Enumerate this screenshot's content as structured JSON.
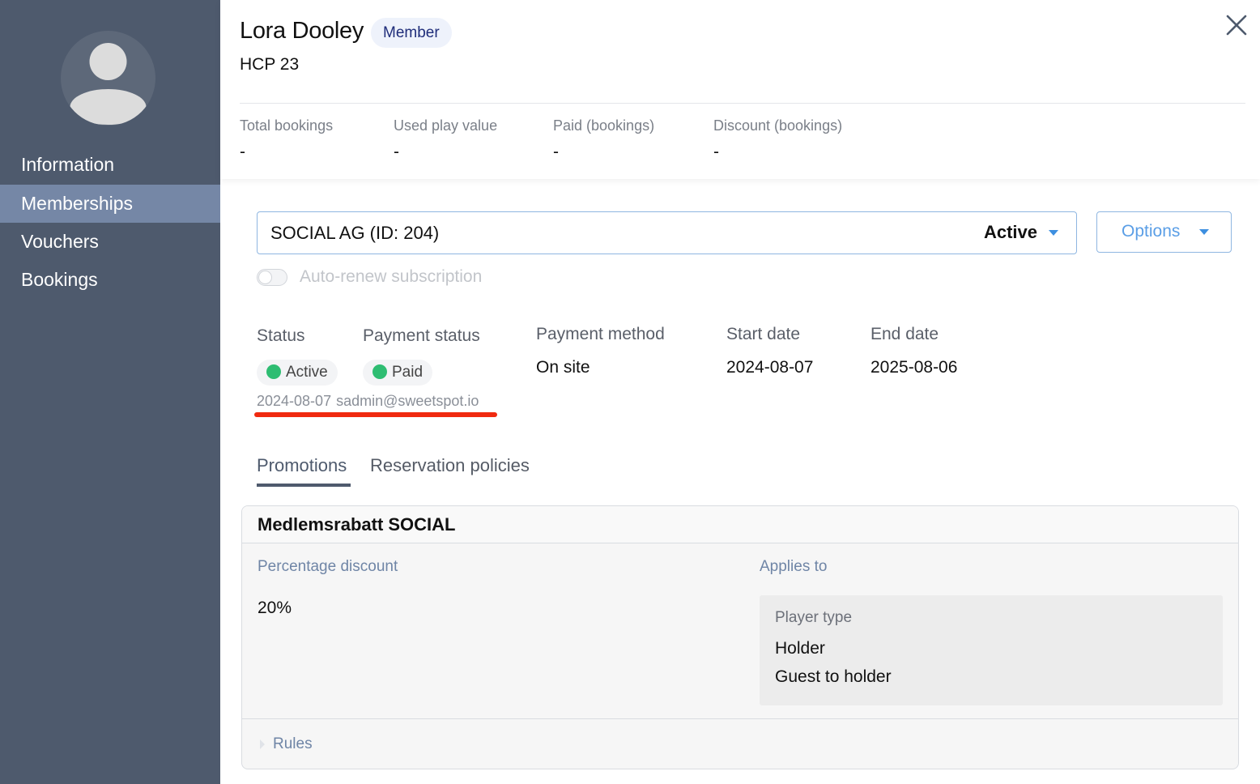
{
  "sidebar": {
    "items": [
      {
        "label": "Information"
      },
      {
        "label": "Memberships"
      },
      {
        "label": "Vouchers"
      },
      {
        "label": "Bookings"
      }
    ],
    "active_index": 1
  },
  "header": {
    "name": "Lora Dooley",
    "badge": "Member",
    "hcp": "HCP 23",
    "stats": [
      {
        "label": "Total bookings",
        "value": "-"
      },
      {
        "label": "Used play value",
        "value": "-"
      },
      {
        "label": "Paid (bookings)",
        "value": "-"
      },
      {
        "label": "Discount (bookings)",
        "value": "-"
      }
    ]
  },
  "membership": {
    "title": "SOCIAL AG (ID: 204)",
    "state": "Active",
    "options_label": "Options",
    "auto_renew_label": "Auto-renew subscription",
    "details": {
      "status_label": "Status",
      "status_value": "Active",
      "payment_status_label": "Payment status",
      "payment_status_value": "Paid",
      "payment_method_label": "Payment method",
      "payment_method_value": "On site",
      "start_date_label": "Start date",
      "start_date_value": "2024-08-07",
      "end_date_label": "End date",
      "end_date_value": "2025-08-06",
      "paid_date": "2024-08-07",
      "paid_by": "sadmin@sweetspot.io"
    }
  },
  "tabs": [
    {
      "label": "Promotions"
    },
    {
      "label": "Reservation policies"
    }
  ],
  "promotion": {
    "title": "Medlemsrabatt SOCIAL",
    "percentage_label": "Percentage discount",
    "percentage_value": "20%",
    "applies_label": "Applies to",
    "player_type_label": "Player type",
    "player_types": [
      "Holder",
      "Guest to holder"
    ],
    "rules_label": "Rules"
  },
  "colors": {
    "sidebar": "#4e5a6d",
    "sidebar_active": "#7587a6",
    "accent_blue": "#3d8fe0",
    "status_green": "#2ebd72",
    "highlight_red": "#f02a10"
  }
}
